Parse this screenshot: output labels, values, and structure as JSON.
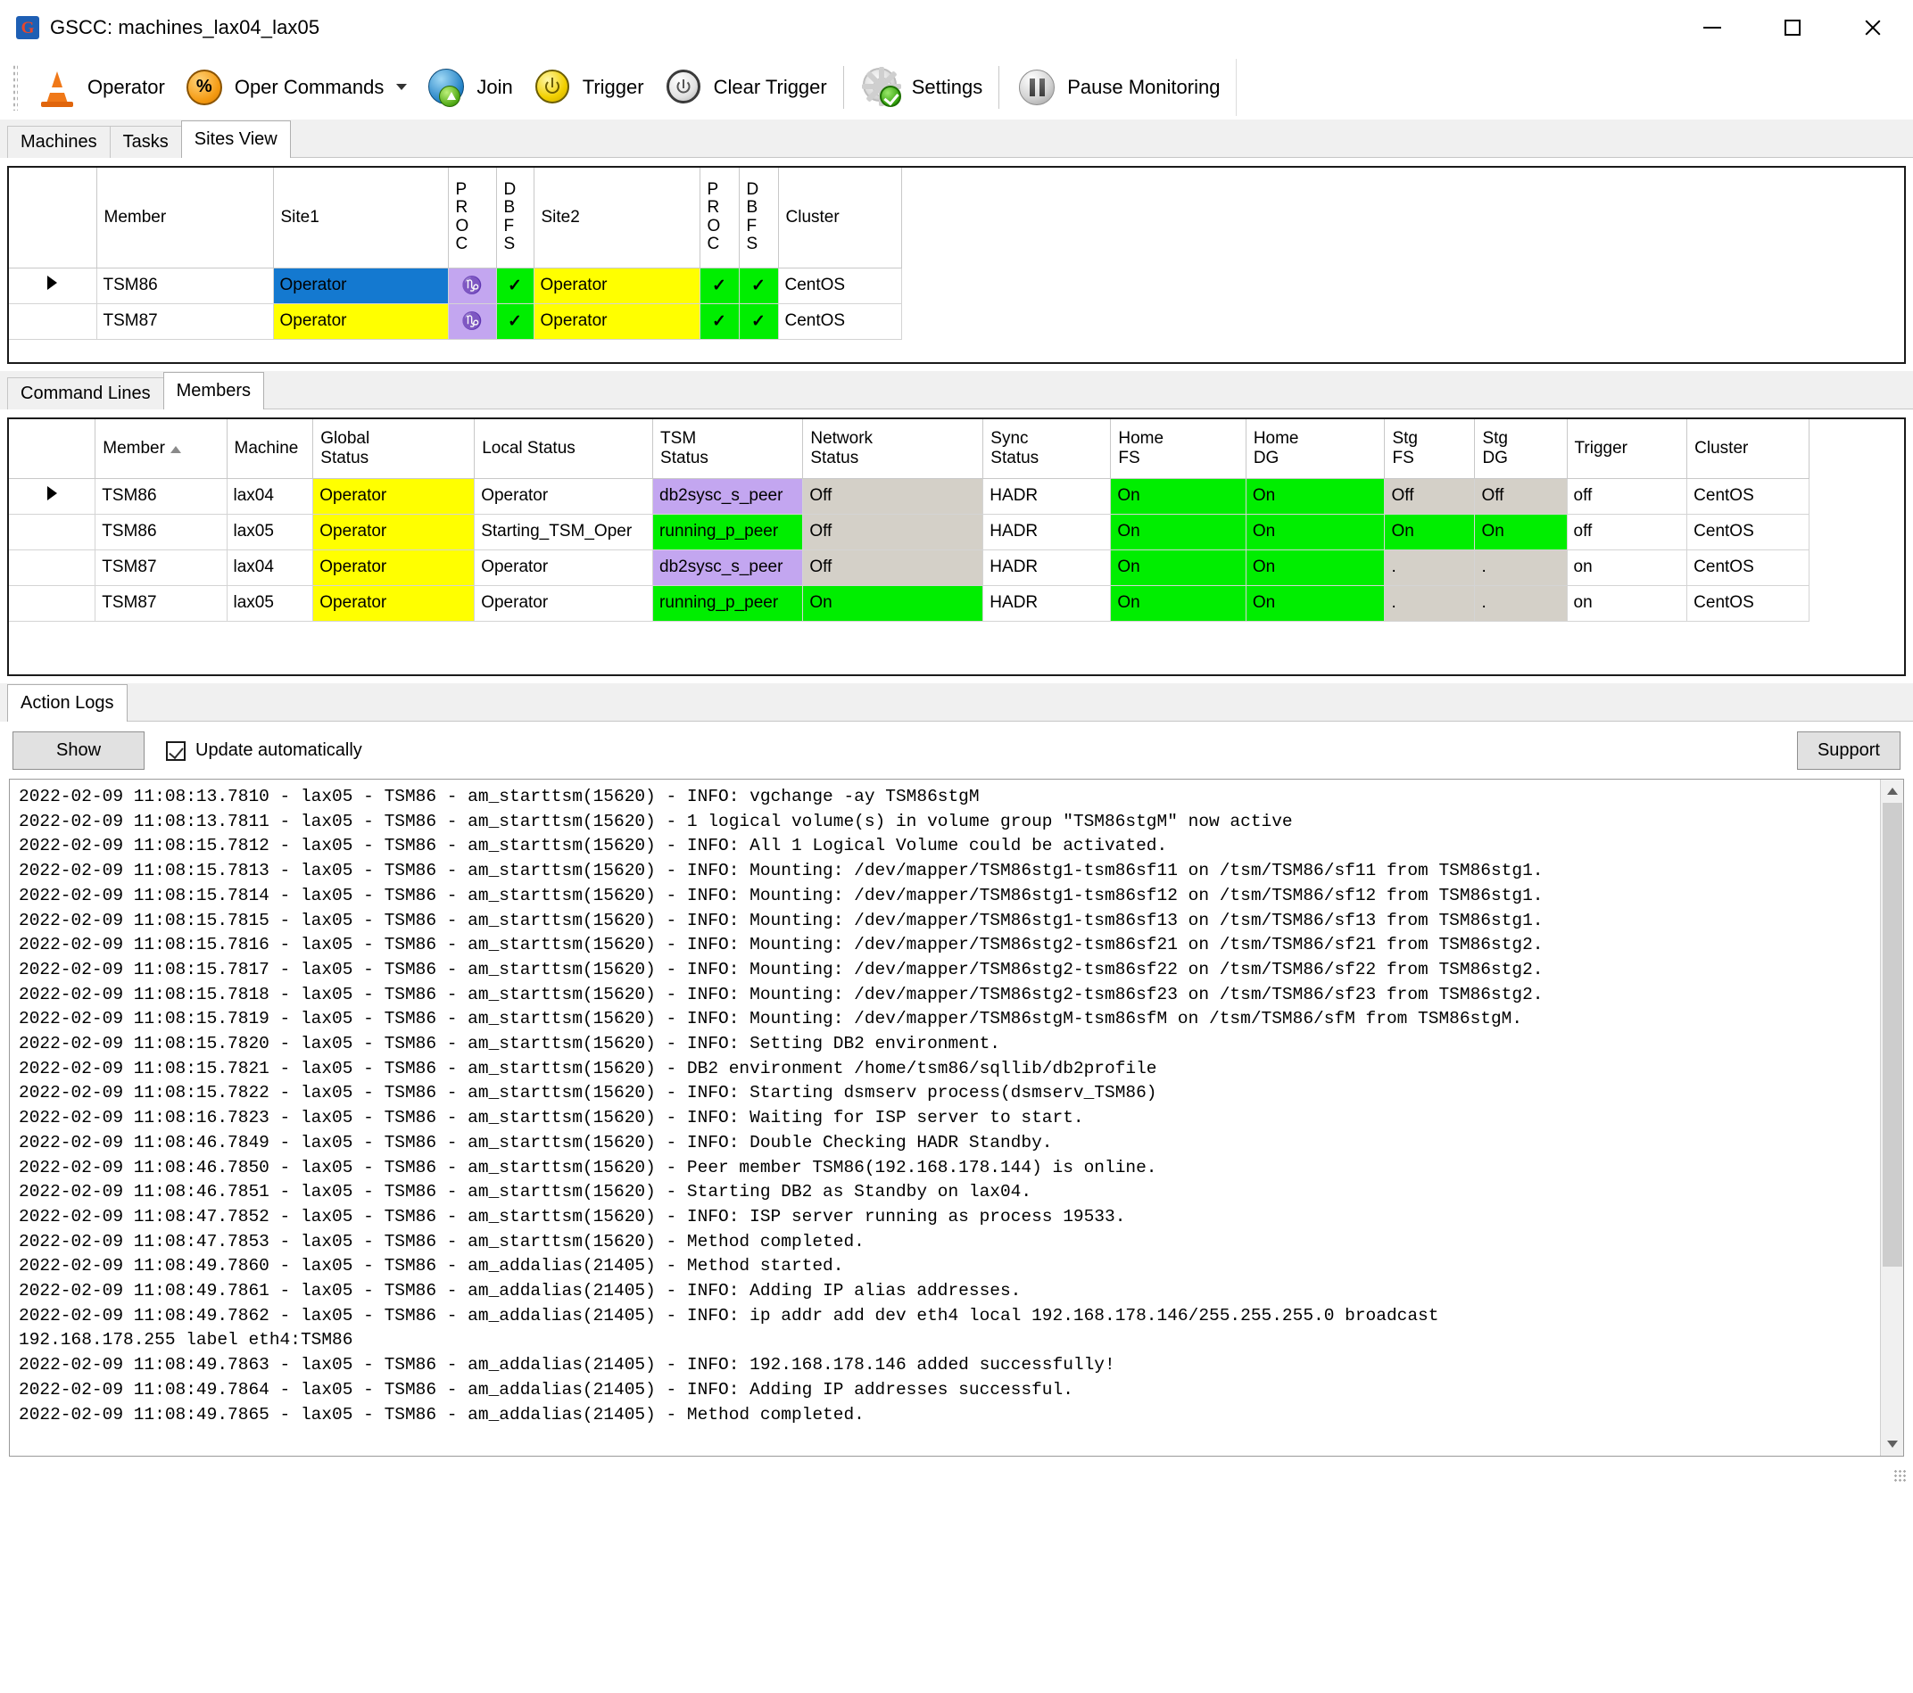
{
  "window": {
    "title": "GSCC: machines_lax04_lax05",
    "app_icon": "G",
    "minimize": "minimize-icon",
    "maximize": "maximize-icon",
    "close": "close-icon"
  },
  "toolbar": {
    "items": [
      {
        "label": "Operator",
        "icon": "traffic-cone-icon",
        "dropdown": false
      },
      {
        "label": "Oper Commands",
        "icon": "percent-circle-icon",
        "dropdown": true
      },
      {
        "label": "Join",
        "icon": "globe-join-icon",
        "dropdown": false
      },
      {
        "label": "Trigger",
        "icon": "power-yellow-icon",
        "dropdown": false
      },
      {
        "label": "Clear Trigger",
        "icon": "power-gray-icon",
        "dropdown": false
      },
      {
        "label": "Settings",
        "icon": "gear-check-icon",
        "dropdown": false
      },
      {
        "label": "Pause Monitoring",
        "icon": "pause-icon",
        "dropdown": false
      }
    ]
  },
  "main_tabs": [
    {
      "label": "Machines",
      "active": false
    },
    {
      "label": "Tasks",
      "active": false
    },
    {
      "label": "Sites View",
      "active": true
    }
  ],
  "sites_grid": {
    "columns": [
      {
        "label": "",
        "key": "rowhdr"
      },
      {
        "label": "Member",
        "key": "member"
      },
      {
        "label": "Site1",
        "key": "site1"
      },
      {
        "label": "P\nR\nO\nC",
        "key": "proc1"
      },
      {
        "label": "D\nB\nF\nS",
        "key": "dbfs1"
      },
      {
        "label": "Site2",
        "key": "site2"
      },
      {
        "label": "P\nR\nO\nC",
        "key": "proc2"
      },
      {
        "label": "D\nB\nF\nS",
        "key": "dbfs2"
      },
      {
        "label": "Cluster",
        "key": "cluster"
      }
    ],
    "rows": [
      {
        "selected": true,
        "member": "TSM86",
        "site1": "Operator",
        "site1_color": "blue",
        "proc1": "cancer-glyph",
        "proc1_color": "purple",
        "dbfs1": "check",
        "dbfs1_color": "green",
        "site2": "Operator",
        "site2_color": "yellow",
        "proc2": "check",
        "proc2_color": "green",
        "dbfs2": "check",
        "dbfs2_color": "green",
        "cluster": "CentOS"
      },
      {
        "selected": false,
        "member": "TSM87",
        "site1": "Operator",
        "site1_color": "yellow",
        "proc1": "cancer-glyph",
        "proc1_color": "purple",
        "dbfs1": "check",
        "dbfs1_color": "green",
        "site2": "Operator",
        "site2_color": "yellow",
        "proc2": "check",
        "proc2_color": "green",
        "dbfs2": "check",
        "dbfs2_color": "green",
        "cluster": "CentOS"
      }
    ]
  },
  "lower_tabs": [
    {
      "label": "Command Lines",
      "active": false
    },
    {
      "label": "Members",
      "active": true
    }
  ],
  "members_grid": {
    "columns": [
      "",
      "Member",
      "Machine",
      "Global\nStatus",
      "Local Status",
      "TSM\nStatus",
      "Network\nStatus",
      "Sync\nStatus",
      "Home\nFS",
      "Home\nDG",
      "Stg\nFS",
      "Stg\nDG",
      "Trigger",
      "Cluster"
    ],
    "sort_column": "Member",
    "sort_direction": "asc",
    "rows": [
      {
        "selected": true,
        "member": "TSM86",
        "machine": "lax04",
        "global_status": "Operator",
        "global_color": "yellow",
        "local_status": "Operator",
        "local_color": "white",
        "tsm_status": "db2sysc_s_peer",
        "tsm_color": "purple",
        "network_status": "Off",
        "network_color": "gray",
        "sync_status": "HADR",
        "sync_color": "white",
        "home_fs": "On",
        "home_fs_color": "green",
        "home_dg": "On",
        "home_dg_color": "green",
        "stg_fs": "Off",
        "stg_fs_color": "gray",
        "stg_dg": "Off",
        "stg_dg_color": "gray",
        "trigger": "off",
        "cluster": "CentOS"
      },
      {
        "selected": false,
        "member": "TSM86",
        "machine": "lax05",
        "global_status": "Operator",
        "global_color": "yellow",
        "local_status": "Starting_TSM_Oper",
        "local_color": "white",
        "tsm_status": "running_p_peer",
        "tsm_color": "green",
        "network_status": "Off",
        "network_color": "gray",
        "sync_status": "HADR",
        "sync_color": "white",
        "home_fs": "On",
        "home_fs_color": "green",
        "home_dg": "On",
        "home_dg_color": "green",
        "stg_fs": "On",
        "stg_fs_color": "green",
        "stg_dg": "On",
        "stg_dg_color": "green",
        "trigger": "off",
        "cluster": "CentOS"
      },
      {
        "selected": false,
        "member": "TSM87",
        "machine": "lax04",
        "global_status": "Operator",
        "global_color": "yellow",
        "local_status": "Operator",
        "local_color": "white",
        "tsm_status": "db2sysc_s_peer",
        "tsm_color": "purple",
        "network_status": "Off",
        "network_color": "gray",
        "sync_status": "HADR",
        "sync_color": "white",
        "home_fs": "On",
        "home_fs_color": "green",
        "home_dg": "On",
        "home_dg_color": "green",
        "stg_fs": ".",
        "stg_fs_color": "gray",
        "stg_dg": ".",
        "stg_dg_color": "gray",
        "trigger": "on",
        "cluster": "CentOS"
      },
      {
        "selected": false,
        "member": "TSM87",
        "machine": "lax05",
        "global_status": "Operator",
        "global_color": "yellow",
        "local_status": "Operator",
        "local_color": "white",
        "tsm_status": "running_p_peer",
        "tsm_color": "green",
        "network_status": "On",
        "network_color": "green",
        "sync_status": "HADR",
        "sync_color": "white",
        "home_fs": "On",
        "home_fs_color": "green",
        "home_dg": "On",
        "home_dg_color": "green",
        "stg_fs": ".",
        "stg_fs_color": "gray",
        "stg_dg": ".",
        "stg_dg_color": "gray",
        "trigger": "on",
        "cluster": "CentOS"
      }
    ]
  },
  "logs_tab": {
    "label": "Action Logs"
  },
  "logs_toolbar": {
    "show_label": "Show",
    "update_label": "Update automatically",
    "update_checked": true,
    "support_label": "Support"
  },
  "log_text": "2022-02-09 11:08:13.7810 - lax05 - TSM86 - am_starttsm(15620) - INFO: vgchange -ay TSM86stgM\n2022-02-09 11:08:13.7811 - lax05 - TSM86 - am_starttsm(15620) - 1 logical volume(s) in volume group \"TSM86stgM\" now active\n2022-02-09 11:08:15.7812 - lax05 - TSM86 - am_starttsm(15620) - INFO: All 1 Logical Volume could be activated.\n2022-02-09 11:08:15.7813 - lax05 - TSM86 - am_starttsm(15620) - INFO: Mounting: /dev/mapper/TSM86stg1-tsm86sf11 on /tsm/TSM86/sf11 from TSM86stg1.\n2022-02-09 11:08:15.7814 - lax05 - TSM86 - am_starttsm(15620) - INFO: Mounting: /dev/mapper/TSM86stg1-tsm86sf12 on /tsm/TSM86/sf12 from TSM86stg1.\n2022-02-09 11:08:15.7815 - lax05 - TSM86 - am_starttsm(15620) - INFO: Mounting: /dev/mapper/TSM86stg1-tsm86sf13 on /tsm/TSM86/sf13 from TSM86stg1.\n2022-02-09 11:08:15.7816 - lax05 - TSM86 - am_starttsm(15620) - INFO: Mounting: /dev/mapper/TSM86stg2-tsm86sf21 on /tsm/TSM86/sf21 from TSM86stg2.\n2022-02-09 11:08:15.7817 - lax05 - TSM86 - am_starttsm(15620) - INFO: Mounting: /dev/mapper/TSM86stg2-tsm86sf22 on /tsm/TSM86/sf22 from TSM86stg2.\n2022-02-09 11:08:15.7818 - lax05 - TSM86 - am_starttsm(15620) - INFO: Mounting: /dev/mapper/TSM86stg2-tsm86sf23 on /tsm/TSM86/sf23 from TSM86stg2.\n2022-02-09 11:08:15.7819 - lax05 - TSM86 - am_starttsm(15620) - INFO: Mounting: /dev/mapper/TSM86stgM-tsm86sfM on /tsm/TSM86/sfM from TSM86stgM.\n2022-02-09 11:08:15.7820 - lax05 - TSM86 - am_starttsm(15620) - INFO: Setting DB2 environment.\n2022-02-09 11:08:15.7821 - lax05 - TSM86 - am_starttsm(15620) - DB2 environment /home/tsm86/sqllib/db2profile\n2022-02-09 11:08:15.7822 - lax05 - TSM86 - am_starttsm(15620) - INFO: Starting dsmserv process(dsmserv_TSM86)\n2022-02-09 11:08:16.7823 - lax05 - TSM86 - am_starttsm(15620) - INFO: Waiting for ISP server to start.\n2022-02-09 11:08:46.7849 - lax05 - TSM86 - am_starttsm(15620) - INFO: Double Checking HADR Standby.\n2022-02-09 11:08:46.7850 - lax05 - TSM86 - am_starttsm(15620) - Peer member TSM86(192.168.178.144) is online.\n2022-02-09 11:08:46.7851 - lax05 - TSM86 - am_starttsm(15620) - Starting DB2 as Standby on lax04.\n2022-02-09 11:08:47.7852 - lax05 - TSM86 - am_starttsm(15620) - INFO: ISP server running as process 19533.\n2022-02-09 11:08:47.7853 - lax05 - TSM86 - am_starttsm(15620) - Method completed.\n2022-02-09 11:08:49.7860 - lax05 - TSM86 - am_addalias(21405) - Method started.\n2022-02-09 11:08:49.7861 - lax05 - TSM86 - am_addalias(21405) - INFO: Adding IP alias addresses.\n2022-02-09 11:08:49.7862 - lax05 - TSM86 - am_addalias(21405) - INFO: ip addr add dev eth4 local 192.168.178.146/255.255.255.0 broadcast\n192.168.178.255 label eth4:TSM86\n2022-02-09 11:08:49.7863 - lax05 - TSM86 - am_addalias(21405) - INFO: 192.168.178.146 added successfully!\n2022-02-09 11:08:49.7864 - lax05 - TSM86 - am_addalias(21405) - INFO: Adding IP addresses successful.\n2022-02-09 11:08:49.7865 - lax05 - TSM86 - am_addalias(21405) - Method completed."
}
